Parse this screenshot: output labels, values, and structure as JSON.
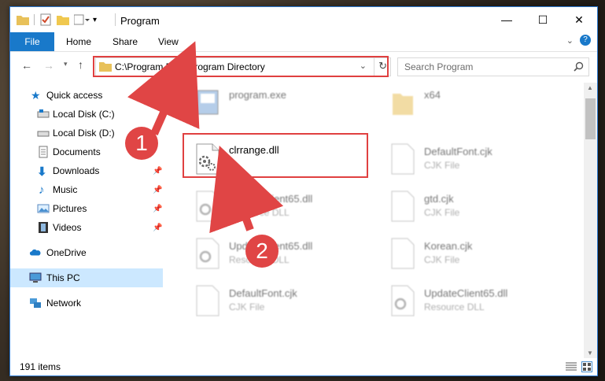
{
  "window": {
    "title": "Program",
    "min": "—",
    "max": "☐",
    "close": "✕"
  },
  "ribbon": {
    "file": "File",
    "home": "Home",
    "share": "Share",
    "view": "View"
  },
  "address": {
    "path": "C:\\Program Files\\Program Directory"
  },
  "search": {
    "placeholder": "Search Program"
  },
  "sidebar": {
    "items": [
      {
        "label": "Quick access"
      },
      {
        "label": "Local Disk (C:)"
      },
      {
        "label": "Local Disk (D:)"
      },
      {
        "label": "Documents"
      },
      {
        "label": "Downloads"
      },
      {
        "label": "Music"
      },
      {
        "label": "Pictures"
      },
      {
        "label": "Videos"
      },
      {
        "label": "OneDrive"
      },
      {
        "label": "This PC"
      },
      {
        "label": "Network"
      }
    ]
  },
  "files": [
    {
      "name": "program.exe",
      "type": ""
    },
    {
      "name": "x64",
      "type": ""
    },
    {
      "name": "clrrange.dll",
      "type": ""
    },
    {
      "name": "DefaultFont.cjk",
      "type": "CJK File"
    },
    {
      "name": "UpdateClient65.dll",
      "type": "Resource DLL"
    },
    {
      "name": "gtd.cjk",
      "type": "CJK File"
    },
    {
      "name": "UpdateClient65.dll",
      "type": "Resource DLL"
    },
    {
      "name": "Korean.cjk",
      "type": "CJK File"
    },
    {
      "name": "DefaultFont.cjk",
      "type": "CJK File"
    },
    {
      "name": "UpdateClient65.dll",
      "type": "Resource DLL"
    }
  ],
  "status": {
    "count": "191 items"
  },
  "annotations": {
    "step1": "1",
    "step2": "2"
  },
  "colors": {
    "accent": "#1979ca",
    "highlight": "#e04040",
    "selection": "#cce8ff"
  }
}
